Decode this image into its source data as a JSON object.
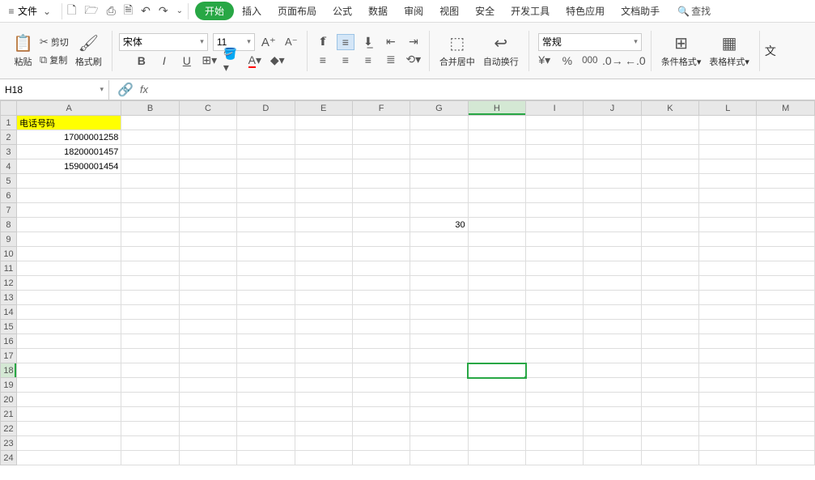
{
  "menubar": {
    "file": "文件",
    "tabs": [
      "开始",
      "插入",
      "页面布局",
      "公式",
      "数据",
      "审阅",
      "视图",
      "安全",
      "开发工具",
      "特色应用",
      "文档助手"
    ],
    "search": "查找"
  },
  "ribbon": {
    "paste": "粘贴",
    "cut": "剪切",
    "copy": "复制",
    "formatPainter": "格式刷",
    "fontName": "宋体",
    "fontSize": "11",
    "mergeCenter": "合并居中",
    "wrapText": "自动换行",
    "numberFormat": "常规",
    "condFormat": "条件格式",
    "tableStyle": "表格样式",
    "text": "文"
  },
  "refbar": {
    "cell": "H18"
  },
  "sheet": {
    "cols": [
      "A",
      "B",
      "C",
      "D",
      "E",
      "F",
      "G",
      "H",
      "I",
      "J",
      "K",
      "L",
      "M"
    ],
    "rowCount": 24,
    "selectedCol": "H",
    "selectedRow": 18,
    "cells": {
      "A1": {
        "value": "电话号码",
        "yellow": true
      },
      "A2": {
        "value": "17000001258"
      },
      "A3": {
        "value": "18200001457"
      },
      "A4": {
        "value": "15900001454"
      },
      "G8": {
        "value": "30"
      }
    }
  }
}
